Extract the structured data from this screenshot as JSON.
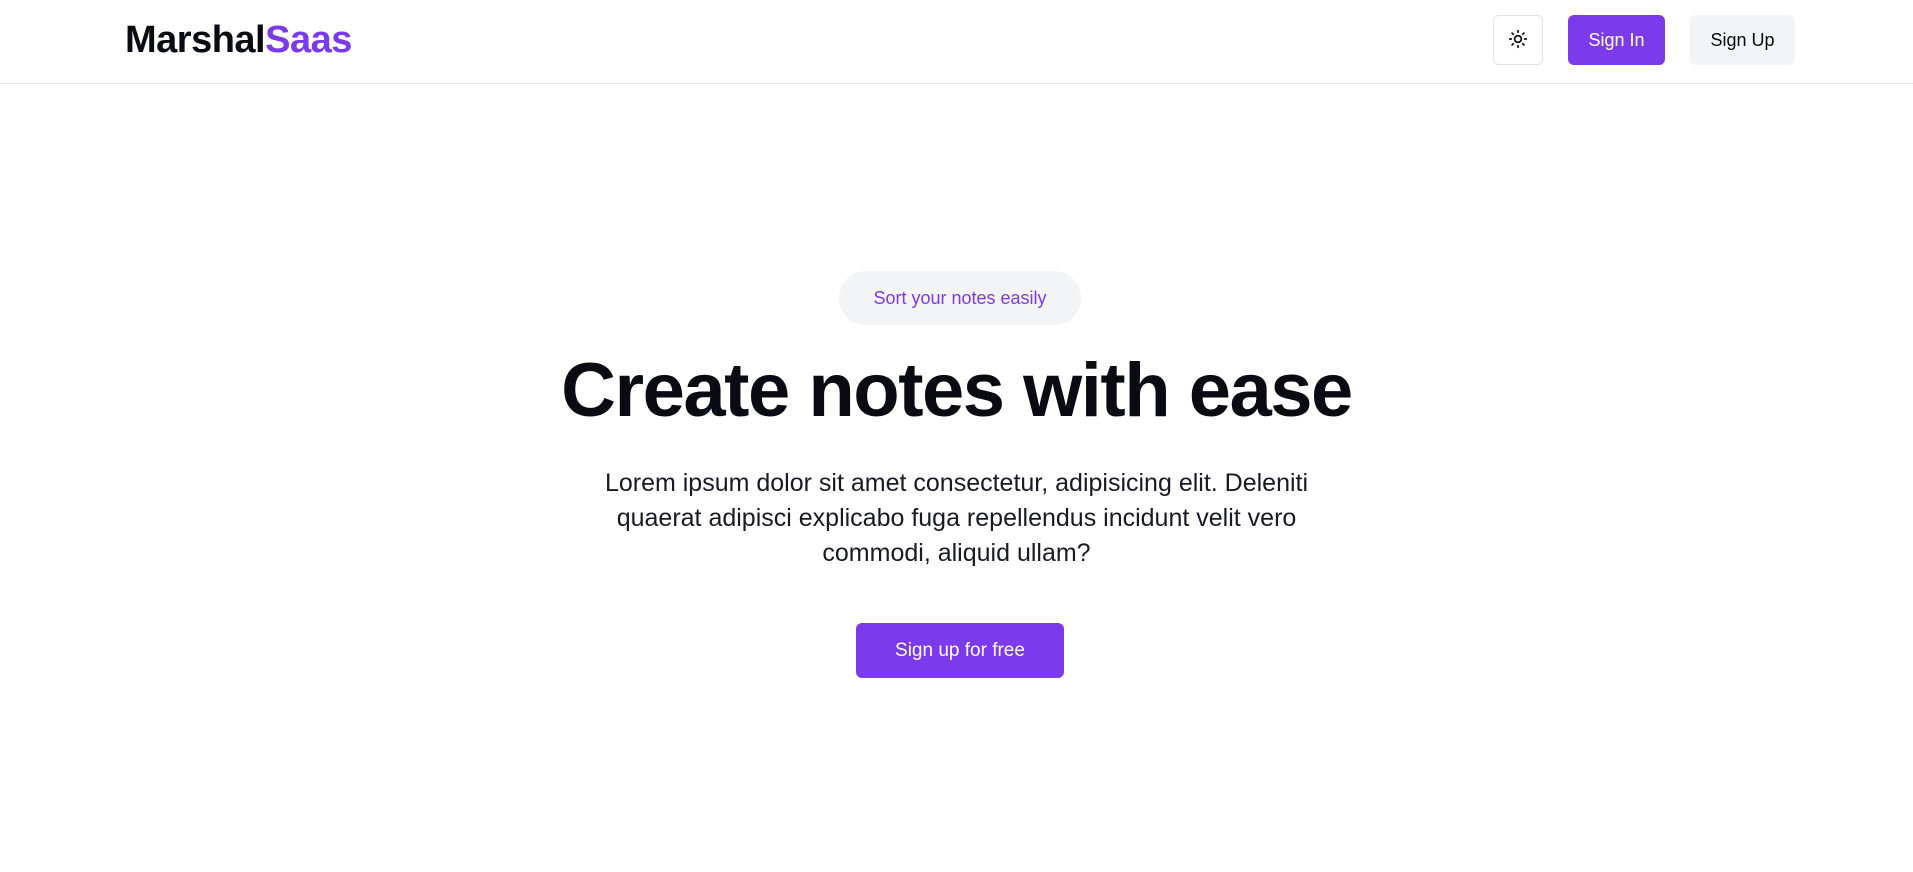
{
  "brand": {
    "part1": "Marshal",
    "part2": "Saas",
    "accent_color": "#7c3aed"
  },
  "nav": {
    "theme_toggle_icon": "sun-icon",
    "sign_in_label": "Sign In",
    "sign_up_label": "Sign Up"
  },
  "hero": {
    "badge": "Sort your notes easily",
    "title": "Create notes with ease",
    "description": "Lorem ipsum dolor sit amet consectetur, adipisicing elit. Deleniti quaerat adipisci explicabo fuga repellendus incidunt velit vero commodi, aliquid ullam?",
    "cta_label": "Sign up for free"
  }
}
